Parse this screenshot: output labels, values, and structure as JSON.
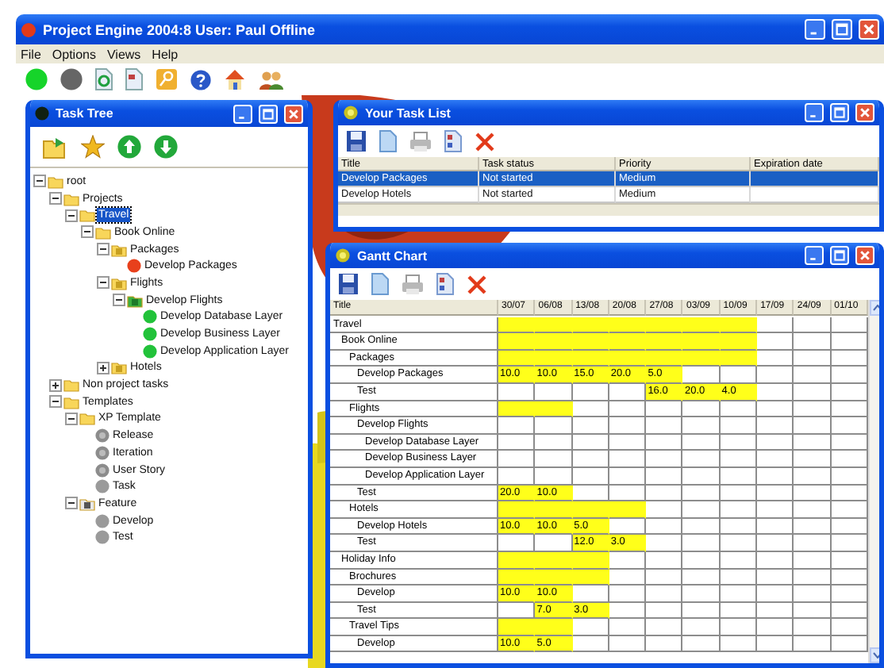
{
  "window": {
    "title": "Project Engine 2004:8  User: Paul  Offline"
  },
  "menu": [
    "File",
    "Options",
    "Views",
    "Help"
  ],
  "task_tree": {
    "title": "Task Tree",
    "items": [
      {
        "label": "root",
        "kind": "folder",
        "expanded": true,
        "selected": false,
        "children": [
          {
            "label": "Projects",
            "kind": "folder",
            "expanded": true,
            "selected": false,
            "children": [
              {
                "label": "Travel",
                "kind": "folder",
                "expanded": true,
                "selected": true,
                "children": [
                  {
                    "label": "Book Online",
                    "kind": "folder",
                    "expanded": true,
                    "selected": false,
                    "children": [
                      {
                        "label": "Packages",
                        "kind": "group",
                        "expanded": true,
                        "selected": false,
                        "children": [
                          {
                            "label": "Develop Packages",
                            "kind": "task",
                            "color": "#e8401c",
                            "selected": false
                          }
                        ]
                      },
                      {
                        "label": "Flights",
                        "kind": "group",
                        "expanded": true,
                        "selected": false,
                        "children": [
                          {
                            "label": "Develop Flights",
                            "kind": "phase",
                            "expanded": true,
                            "selected": false,
                            "children": [
                              {
                                "label": "Develop Database Layer",
                                "kind": "task",
                                "color": "#22c23a",
                                "selected": false
                              },
                              {
                                "label": "Develop Business Layer",
                                "kind": "task",
                                "color": "#22c23a",
                                "selected": false
                              },
                              {
                                "label": "Develop Application Layer",
                                "kind": "task",
                                "color": "#22c23a",
                                "selected": false
                              }
                            ]
                          }
                        ]
                      },
                      {
                        "label": "Hotels",
                        "kind": "group",
                        "expanded": false,
                        "selected": false
                      }
                    ]
                  }
                ]
              }
            ]
          },
          {
            "label": "Non project tasks",
            "kind": "folder",
            "expanded": false,
            "selected": false
          },
          {
            "label": "Templates",
            "kind": "folder",
            "expanded": true,
            "selected": false,
            "children": [
              {
                "label": "XP Template",
                "kind": "folder",
                "expanded": true,
                "selected": false,
                "children": [
                  {
                    "label": "Release",
                    "kind": "template",
                    "color": "#8c8c8c",
                    "selected": false
                  },
                  {
                    "label": "Iteration",
                    "kind": "template",
                    "color": "#8c8c8c",
                    "selected": false
                  },
                  {
                    "label": "User Story",
                    "kind": "template",
                    "color": "#8c8c8c",
                    "selected": false
                  },
                  {
                    "label": "Task",
                    "kind": "task",
                    "color": "#9a9a9a",
                    "selected": false
                  }
                ]
              },
              {
                "label": "Feature",
                "kind": "feature",
                "expanded": true,
                "selected": false,
                "children": [
                  {
                    "label": "Develop",
                    "kind": "task",
                    "color": "#9a9a9a",
                    "selected": false
                  },
                  {
                    "label": "Test",
                    "kind": "task",
                    "color": "#9a9a9a",
                    "selected": false
                  }
                ]
              }
            ]
          }
        ]
      }
    ]
  },
  "task_list": {
    "title": "Your Task List",
    "columns": [
      "Title",
      "Task status",
      "Priority",
      "Expiration date"
    ],
    "rows": [
      {
        "cells": [
          "Develop Packages",
          "Not started",
          "Medium"
        ],
        "selected": true
      },
      {
        "cells": [
          "Develop Hotels",
          "Not started",
          "Medium"
        ],
        "selected": false
      }
    ]
  },
  "gantt": {
    "title": "Gantt Chart",
    "columns": [
      "Title",
      "30/07",
      "06/08",
      "13/08",
      "20/08",
      "27/08",
      "03/09",
      "10/09",
      "17/09",
      "24/09",
      "01/10"
    ],
    "rows": [
      {
        "title": "Travel",
        "cells": [
          {
            "filled": true
          },
          {
            "filled": true
          },
          {
            "filled": true
          },
          {
            "filled": true
          },
          {
            "filled": true
          },
          {
            "filled": true
          },
          {
            "filled": true
          },
          {
            "filled": false
          },
          {
            "filled": false
          },
          {
            "filled": false
          }
        ],
        "children": [
          {
            "title": "Book Online",
            "cells": [
              {
                "filled": true
              },
              {
                "filled": true
              },
              {
                "filled": true
              },
              {
                "filled": true
              },
              {
                "filled": true
              },
              {
                "filled": true
              },
              {
                "filled": true
              },
              {
                "filled": false
              },
              {
                "filled": false
              },
              {
                "filled": false
              }
            ],
            "children": [
              {
                "title": "Packages",
                "cells": [
                  {
                    "filled": true
                  },
                  {
                    "filled": true
                  },
                  {
                    "filled": true
                  },
                  {
                    "filled": true
                  },
                  {
                    "filled": true
                  },
                  {
                    "filled": true
                  },
                  {
                    "filled": true
                  },
                  {
                    "filled": false
                  },
                  {
                    "filled": false
                  },
                  {
                    "filled": false
                  }
                ],
                "children": [
                  {
                    "title": "Develop Packages",
                    "cells": [
                      {
                        "filled": true,
                        "value": "10.0"
                      },
                      {
                        "filled": true,
                        "value": "10.0"
                      },
                      {
                        "filled": true,
                        "value": "15.0"
                      },
                      {
                        "filled": true,
                        "value": "20.0"
                      },
                      {
                        "filled": true,
                        "value": "5.0"
                      },
                      {
                        "filled": false
                      },
                      {
                        "filled": false
                      },
                      {
                        "filled": false
                      },
                      {
                        "filled": false
                      },
                      {
                        "filled": false
                      }
                    ]
                  },
                  {
                    "title": "Test",
                    "cells": [
                      {
                        "filled": false
                      },
                      {
                        "filled": false
                      },
                      {
                        "filled": false
                      },
                      {
                        "filled": false
                      },
                      {
                        "filled": true,
                        "value": "16.0"
                      },
                      {
                        "filled": true,
                        "value": "20.0"
                      },
                      {
                        "filled": true,
                        "value": "4.0"
                      },
                      {
                        "filled": false
                      },
                      {
                        "filled": false
                      },
                      {
                        "filled": false
                      }
                    ]
                  }
                ]
              },
              {
                "title": "Flights",
                "cells": [
                  {
                    "filled": true
                  },
                  {
                    "filled": true
                  },
                  {
                    "filled": false
                  },
                  {
                    "filled": false
                  },
                  {
                    "filled": false
                  },
                  {
                    "filled": false
                  },
                  {
                    "filled": false
                  },
                  {
                    "filled": false
                  },
                  {
                    "filled": false
                  },
                  {
                    "filled": false
                  }
                ],
                "children": [
                  {
                    "title": "Develop Flights",
                    "cells": [
                      {
                        "filled": false
                      },
                      {
                        "filled": false
                      },
                      {
                        "filled": false
                      },
                      {
                        "filled": false
                      },
                      {
                        "filled": false
                      },
                      {
                        "filled": false
                      },
                      {
                        "filled": false
                      },
                      {
                        "filled": false
                      },
                      {
                        "filled": false
                      },
                      {
                        "filled": false
                      }
                    ],
                    "children": [
                      {
                        "title": "Develop Database Layer",
                        "cells": [
                          {
                            "filled": false
                          },
                          {
                            "filled": false
                          },
                          {
                            "filled": false
                          },
                          {
                            "filled": false
                          },
                          {
                            "filled": false
                          },
                          {
                            "filled": false
                          },
                          {
                            "filled": false
                          },
                          {
                            "filled": false
                          },
                          {
                            "filled": false
                          },
                          {
                            "filled": false
                          }
                        ]
                      },
                      {
                        "title": "Develop Business Layer",
                        "cells": [
                          {
                            "filled": false
                          },
                          {
                            "filled": false
                          },
                          {
                            "filled": false
                          },
                          {
                            "filled": false
                          },
                          {
                            "filled": false
                          },
                          {
                            "filled": false
                          },
                          {
                            "filled": false
                          },
                          {
                            "filled": false
                          },
                          {
                            "filled": false
                          },
                          {
                            "filled": false
                          }
                        ]
                      },
                      {
                        "title": "Develop Application Layer",
                        "cells": [
                          {
                            "filled": false
                          },
                          {
                            "filled": false
                          },
                          {
                            "filled": false
                          },
                          {
                            "filled": false
                          },
                          {
                            "filled": false
                          },
                          {
                            "filled": false
                          },
                          {
                            "filled": false
                          },
                          {
                            "filled": false
                          },
                          {
                            "filled": false
                          },
                          {
                            "filled": false
                          }
                        ]
                      }
                    ]
                  },
                  {
                    "title": "Test",
                    "cells": [
                      {
                        "filled": true,
                        "value": "20.0"
                      },
                      {
                        "filled": true,
                        "value": "10.0"
                      },
                      {
                        "filled": false
                      },
                      {
                        "filled": false
                      },
                      {
                        "filled": false
                      },
                      {
                        "filled": false
                      },
                      {
                        "filled": false
                      },
                      {
                        "filled": false
                      },
                      {
                        "filled": false
                      },
                      {
                        "filled": false
                      }
                    ]
                  }
                ]
              },
              {
                "title": "Hotels",
                "cells": [
                  {
                    "filled": true
                  },
                  {
                    "filled": true
                  },
                  {
                    "filled": true
                  },
                  {
                    "filled": true
                  },
                  {
                    "filled": false
                  },
                  {
                    "filled": false
                  },
                  {
                    "filled": false
                  },
                  {
                    "filled": false
                  },
                  {
                    "filled": false
                  },
                  {
                    "filled": false
                  }
                ],
                "children": [
                  {
                    "title": "Develop Hotels",
                    "cells": [
                      {
                        "filled": true,
                        "value": "10.0"
                      },
                      {
                        "filled": true,
                        "value": "10.0"
                      },
                      {
                        "filled": true,
                        "value": "5.0"
                      },
                      {
                        "filled": false
                      },
                      {
                        "filled": false
                      },
                      {
                        "filled": false
                      },
                      {
                        "filled": false
                      },
                      {
                        "filled": false
                      },
                      {
                        "filled": false
                      },
                      {
                        "filled": false
                      }
                    ]
                  },
                  {
                    "title": "Test",
                    "cells": [
                      {
                        "filled": false
                      },
                      {
                        "filled": false
                      },
                      {
                        "filled": true,
                        "value": "12.0"
                      },
                      {
                        "filled": true,
                        "value": "3.0"
                      },
                      {
                        "filled": false
                      },
                      {
                        "filled": false
                      },
                      {
                        "filled": false
                      },
                      {
                        "filled": false
                      },
                      {
                        "filled": false
                      },
                      {
                        "filled": false
                      }
                    ]
                  }
                ]
              }
            ]
          },
          {
            "title": "Holiday Info",
            "cells": [
              {
                "filled": true
              },
              {
                "filled": true
              },
              {
                "filled": true
              },
              {
                "filled": false
              },
              {
                "filled": false
              },
              {
                "filled": false
              },
              {
                "filled": false
              },
              {
                "filled": false
              },
              {
                "filled": false
              },
              {
                "filled": false
              }
            ],
            "children": [
              {
                "title": "Brochures",
                "cells": [
                  {
                    "filled": true
                  },
                  {
                    "filled": true
                  },
                  {
                    "filled": true
                  },
                  {
                    "filled": false
                  },
                  {
                    "filled": false
                  },
                  {
                    "filled": false
                  },
                  {
                    "filled": false
                  },
                  {
                    "filled": false
                  },
                  {
                    "filled": false
                  },
                  {
                    "filled": false
                  }
                ],
                "children": [
                  {
                    "title": "Develop",
                    "cells": [
                      {
                        "filled": true,
                        "value": "10.0"
                      },
                      {
                        "filled": true,
                        "value": "10.0"
                      },
                      {
                        "filled": false
                      },
                      {
                        "filled": false
                      },
                      {
                        "filled": false
                      },
                      {
                        "filled": false
                      },
                      {
                        "filled": false
                      },
                      {
                        "filled": false
                      },
                      {
                        "filled": false
                      },
                      {
                        "filled": false
                      }
                    ]
                  },
                  {
                    "title": "Test",
                    "cells": [
                      {
                        "filled": false
                      },
                      {
                        "filled": true,
                        "value": "7.0"
                      },
                      {
                        "filled": true,
                        "value": "3.0"
                      },
                      {
                        "filled": false
                      },
                      {
                        "filled": false
                      },
                      {
                        "filled": false
                      },
                      {
                        "filled": false
                      },
                      {
                        "filled": false
                      },
                      {
                        "filled": false
                      },
                      {
                        "filled": false
                      }
                    ]
                  }
                ]
              },
              {
                "title": "Travel Tips",
                "cells": [
                  {
                    "filled": true
                  },
                  {
                    "filled": true
                  },
                  {
                    "filled": false
                  },
                  {
                    "filled": false
                  },
                  {
                    "filled": false
                  },
                  {
                    "filled": false
                  },
                  {
                    "filled": false
                  },
                  {
                    "filled": false
                  },
                  {
                    "filled": false
                  },
                  {
                    "filled": false
                  }
                ],
                "children": [
                  {
                    "title": "Develop",
                    "cells": [
                      {
                        "filled": true,
                        "value": "10.0"
                      },
                      {
                        "filled": true,
                        "value": "5.0"
                      },
                      {
                        "filled": false
                      },
                      {
                        "filled": false
                      },
                      {
                        "filled": false
                      },
                      {
                        "filled": false
                      },
                      {
                        "filled": false
                      },
                      {
                        "filled": false
                      },
                      {
                        "filled": false
                      },
                      {
                        "filled": false
                      }
                    ]
                  }
                ]
              }
            ]
          }
        ]
      }
    ]
  }
}
